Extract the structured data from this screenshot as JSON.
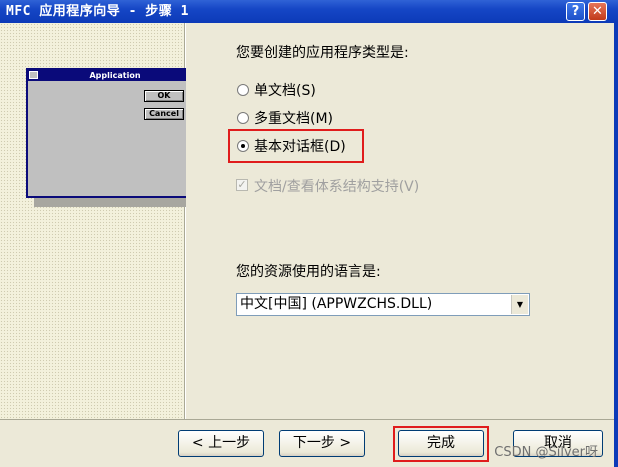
{
  "window": {
    "title": "MFC 应用程序向导 - 步骤 1",
    "help_label": "?",
    "close_label": "✕"
  },
  "preview": {
    "title": "Application",
    "ok_label": "OK",
    "cancel_label": "Cancel"
  },
  "app_type": {
    "question": "您要创建的应用程序类型是:",
    "options": [
      {
        "label": "单文档(S)",
        "selected": false
      },
      {
        "label": "多重文档(M)",
        "selected": false
      },
      {
        "label": "基本对话框(D)",
        "selected": true
      }
    ],
    "doc_view_label": "文档/查看体系结构支持(V)",
    "doc_view_checked": true,
    "doc_view_enabled": false
  },
  "language": {
    "question": "您的资源使用的语言是:",
    "selected": "中文[中国] (APPWZCHS.DLL)"
  },
  "buttons": {
    "back": "< 上一步",
    "next": "下一步 >",
    "finish": "完成",
    "cancel": "取消"
  },
  "watermark": "CSDN @Silver呀",
  "colors": {
    "title_bar": "#0c3ab8",
    "dialog_bg": "#ece9d8",
    "highlight": "#e01c1c"
  }
}
